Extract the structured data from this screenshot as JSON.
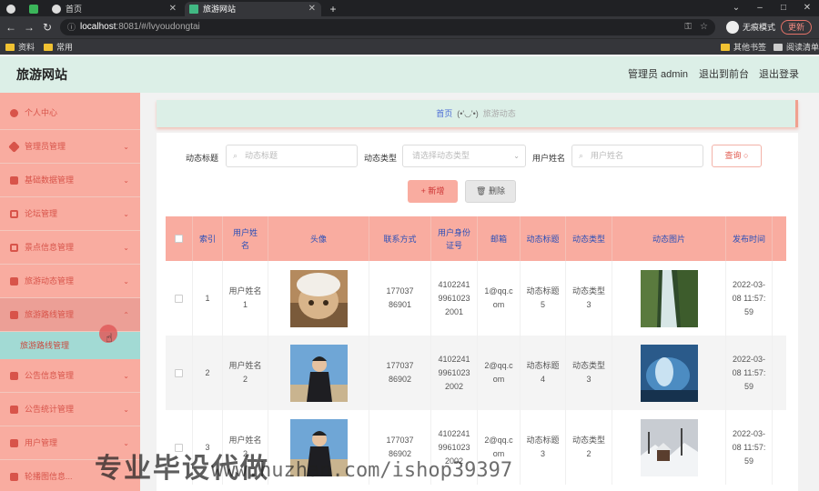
{
  "browser": {
    "tabs": [
      {
        "label": "",
        "active": false
      },
      {
        "label": "",
        "active": false
      },
      {
        "label": "首页",
        "active": false
      },
      {
        "label": "旅游网站",
        "active": true
      }
    ],
    "new_tab": "+",
    "url_host": "localhost",
    "url_path": ":8081/#/lvyoudongtai",
    "incognito_label": "无痕模式",
    "update_label": "更新",
    "bookmarks": [
      "资料",
      "常用",
      "其他书签",
      "阅读清单"
    ]
  },
  "header": {
    "title": "旅游网站",
    "admin_label": "管理员 admin",
    "back_label": "退出到前台",
    "logout_label": "退出登录"
  },
  "sidebar": {
    "items": [
      {
        "label": "个人中心"
      },
      {
        "label": "管理员管理"
      },
      {
        "label": "基础数据管理"
      },
      {
        "label": "论坛管理"
      },
      {
        "label": "景点信息管理"
      },
      {
        "label": "旅游动态管理"
      },
      {
        "label": "旅游路线管理"
      },
      {
        "label": "公告信息管理"
      },
      {
        "label": "公告统计管理"
      },
      {
        "label": "用户管理"
      },
      {
        "label": "轮播图信息..."
      }
    ],
    "submenu_label": "旅游路线管理"
  },
  "breadcrumb": {
    "home": "首页",
    "sep": "(•'◡'•)",
    "current": "旅游动态"
  },
  "filters": {
    "title_label": "动态标题",
    "title_placeholder": "动态标题",
    "type_label": "动态类型",
    "type_placeholder": "请选择动态类型",
    "user_label": "用户姓名",
    "user_placeholder": "用户姓名",
    "query_label": "查询 ○",
    "add_label": "+ 新增",
    "delete_label": "删除"
  },
  "table": {
    "headers": [
      "",
      "索引",
      "用户姓名",
      "头像",
      "联系方式",
      "用户身份证号",
      "邮箱",
      "动态标题",
      "动态类型",
      "动态图片",
      "发布时间"
    ],
    "rows": [
      {
        "index": "1",
        "name": "用户姓名1",
        "phone": "17703786901",
        "idcard": "410224199610232001",
        "email": "1@qq.com",
        "title": "动态标题5",
        "type": "动态类型3",
        "time": "2022-03-08 11:57:59"
      },
      {
        "index": "2",
        "name": "用户姓名2",
        "phone": "17703786902",
        "idcard": "410224199610232002",
        "email": "2@qq.com",
        "title": "动态标题4",
        "type": "动态类型3",
        "time": "2022-03-08 11:57:59"
      },
      {
        "index": "3",
        "name": "用户姓名2",
        "phone": "17703786902",
        "idcard": "410224199610232002",
        "email": "2@qq.com",
        "title": "动态标题3",
        "type": "动态类型2",
        "time": "2022-03-08 11:57:59"
      }
    ]
  },
  "watermark": {
    "text": "专业毕设代做",
    "url": "www.huzhan.com/ishop39397"
  }
}
